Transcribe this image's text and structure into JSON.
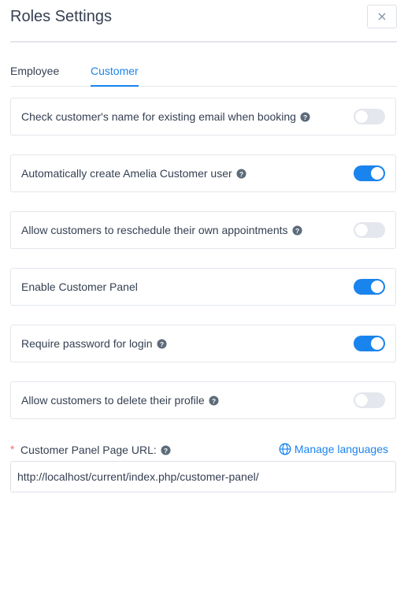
{
  "dialog": {
    "title": "Roles Settings",
    "close_symbol": "✕",
    "close_icon": "close-icon"
  },
  "tabs": [
    {
      "label": "Employee",
      "active": false
    },
    {
      "label": "Customer",
      "active": true
    }
  ],
  "settings": [
    {
      "label": "Check customer's name for existing email when booking",
      "help": true,
      "enabled": false
    },
    {
      "label": "Automatically create Amelia Customer user",
      "help": true,
      "enabled": true
    },
    {
      "label": "Allow customers to reschedule their own appointments",
      "help": true,
      "enabled": false
    },
    {
      "label": "Enable Customer Panel",
      "help": false,
      "enabled": true
    },
    {
      "label": "Require password for login",
      "help": true,
      "enabled": true
    },
    {
      "label": "Allow customers to delete their profile",
      "help": true,
      "enabled": false
    }
  ],
  "customer_panel_url": {
    "required_marker": "*",
    "label": "Customer Panel Page URL:",
    "help_icon": "question-circle-icon",
    "manage_languages_label": "Manage languages",
    "manage_languages_icon": "globe-icon",
    "value": "http://localhost/current/index.php/customer-panel/"
  },
  "colors": {
    "accent": "#1a84ee",
    "toggle_off": "#e4e7ed",
    "text": "#354052",
    "required": "#f56c6c"
  }
}
